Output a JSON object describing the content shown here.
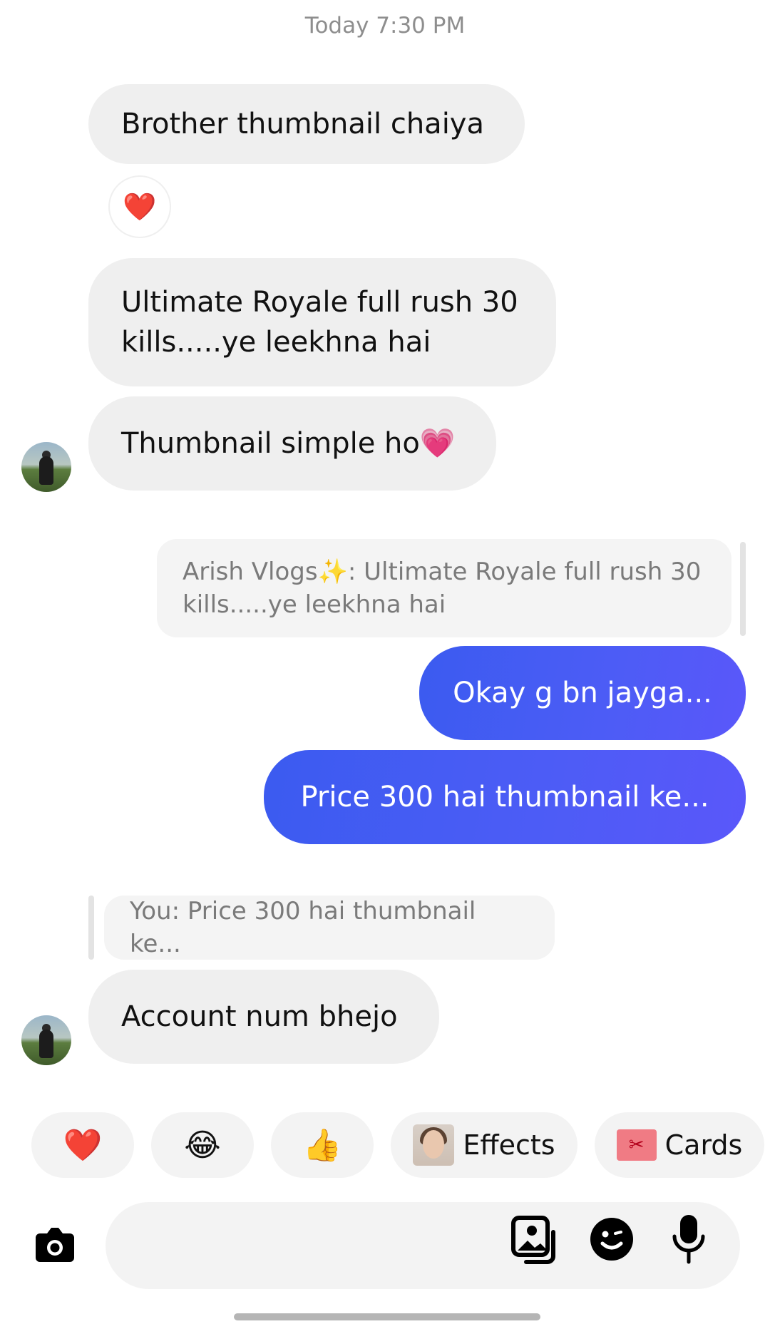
{
  "thread": {
    "timestamp": "Today 7:30 PM",
    "messages": [
      {
        "sender": "them",
        "text": "Brother thumbnail chaiya",
        "reaction": "❤️"
      },
      {
        "sender": "them",
        "lines": [
          "Ultimate Royale full rush 30",
          "kills.....ye leekhna hai"
        ]
      },
      {
        "sender": "them",
        "text": "Thumbnail simple ho💗"
      },
      {
        "sender": "me",
        "reply_to_lines": [
          "Arish Vlogs✨: Ultimate Royale full rush 30",
          "kills.....ye leekhna hai"
        ]
      },
      {
        "sender": "me",
        "text": "Okay g bn jayga..."
      },
      {
        "sender": "me",
        "text": "Price 300 hai thumbnail ke..."
      },
      {
        "sender": "them",
        "reply_to": "You: Price 300 hai thumbnail ke..."
      },
      {
        "sender": "them",
        "text": "Account num bhejo"
      }
    ]
  },
  "quick_reactions": {
    "heart": "❤️",
    "laugh": "😂",
    "thumbs_up": "👍",
    "effects_label": "Effects",
    "cards_label": "Cards"
  },
  "composer": {
    "icons": [
      "camera-icon",
      "gallery-icon",
      "sticker-icon",
      "microphone-icon"
    ]
  },
  "colors": {
    "outgoing_bubble": "#4a5cf5",
    "incoming_bubble": "#efefef"
  }
}
